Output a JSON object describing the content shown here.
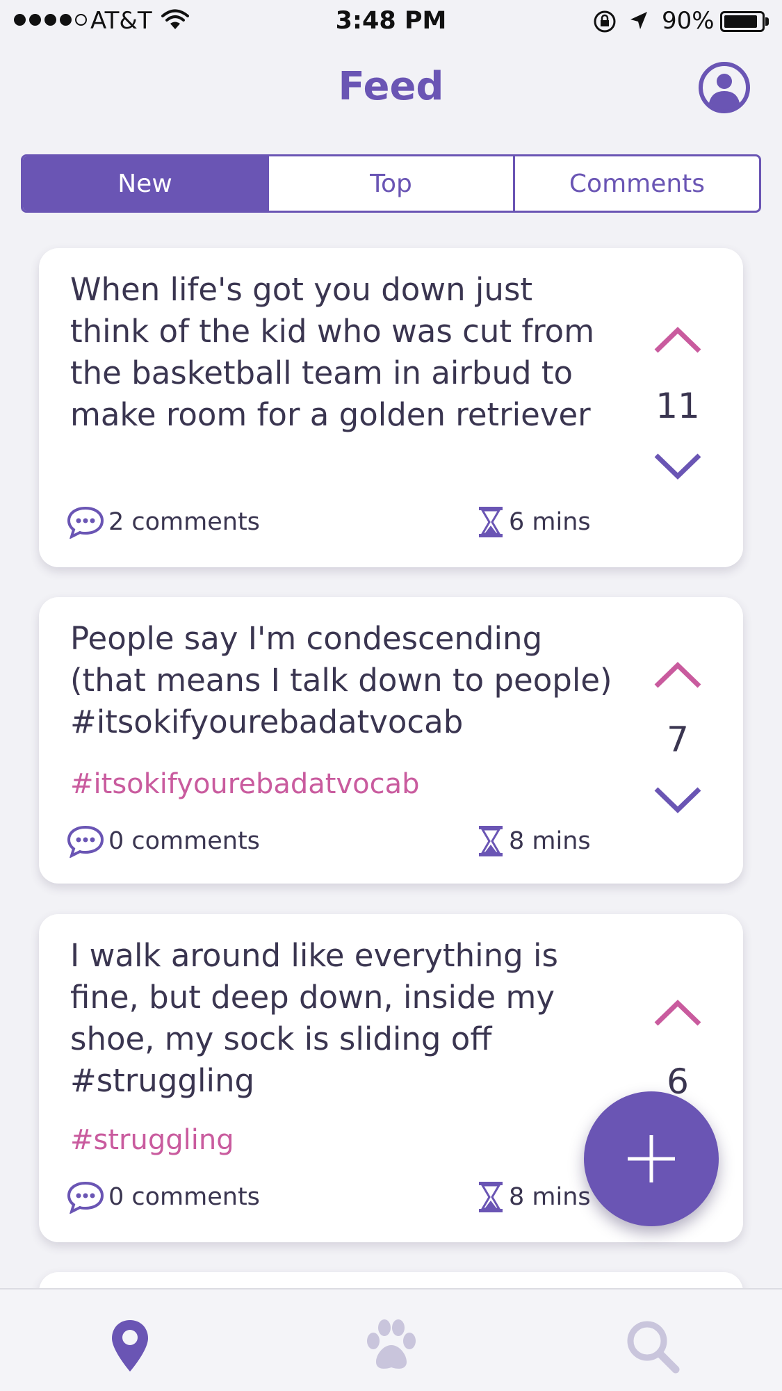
{
  "status_bar": {
    "carrier": "AT&T",
    "time": "3:48 PM",
    "battery": "90%",
    "battery_level": 0.9
  },
  "header": {
    "title": "Feed"
  },
  "tabs": [
    {
      "label": "New",
      "active": true
    },
    {
      "label": "Top",
      "active": false
    },
    {
      "label": "Comments",
      "active": false
    }
  ],
  "posts": [
    {
      "text": "When life's got you down just think of the kid who was cut from the basketball team in airbud to make room for a golden retriever",
      "tag": "",
      "votes": "11",
      "comments": "2 comments",
      "age": "6 mins"
    },
    {
      "text": "People say I'm condescending (that means I talk down to people) #itsokifyourebadatvocab",
      "tag": "#itsokifyourebadatvocab",
      "votes": "7",
      "comments": "0 comments",
      "age": "8 mins"
    },
    {
      "text": "I walk around like everything is fine, but deep down, inside my shoe, my sock is sliding off #struggling",
      "tag": "#struggling",
      "votes": "6",
      "comments": "0 comments",
      "age": "8 mins"
    }
  ],
  "colors": {
    "primary": "#6a55b4",
    "accent": "#c95b9e",
    "inactive": "#c9c5dc"
  },
  "icons": {
    "tab_bar": [
      "location-pin-icon",
      "paw-icon",
      "search-icon"
    ],
    "fab": "plus-icon",
    "profile": "user-circle-icon"
  }
}
